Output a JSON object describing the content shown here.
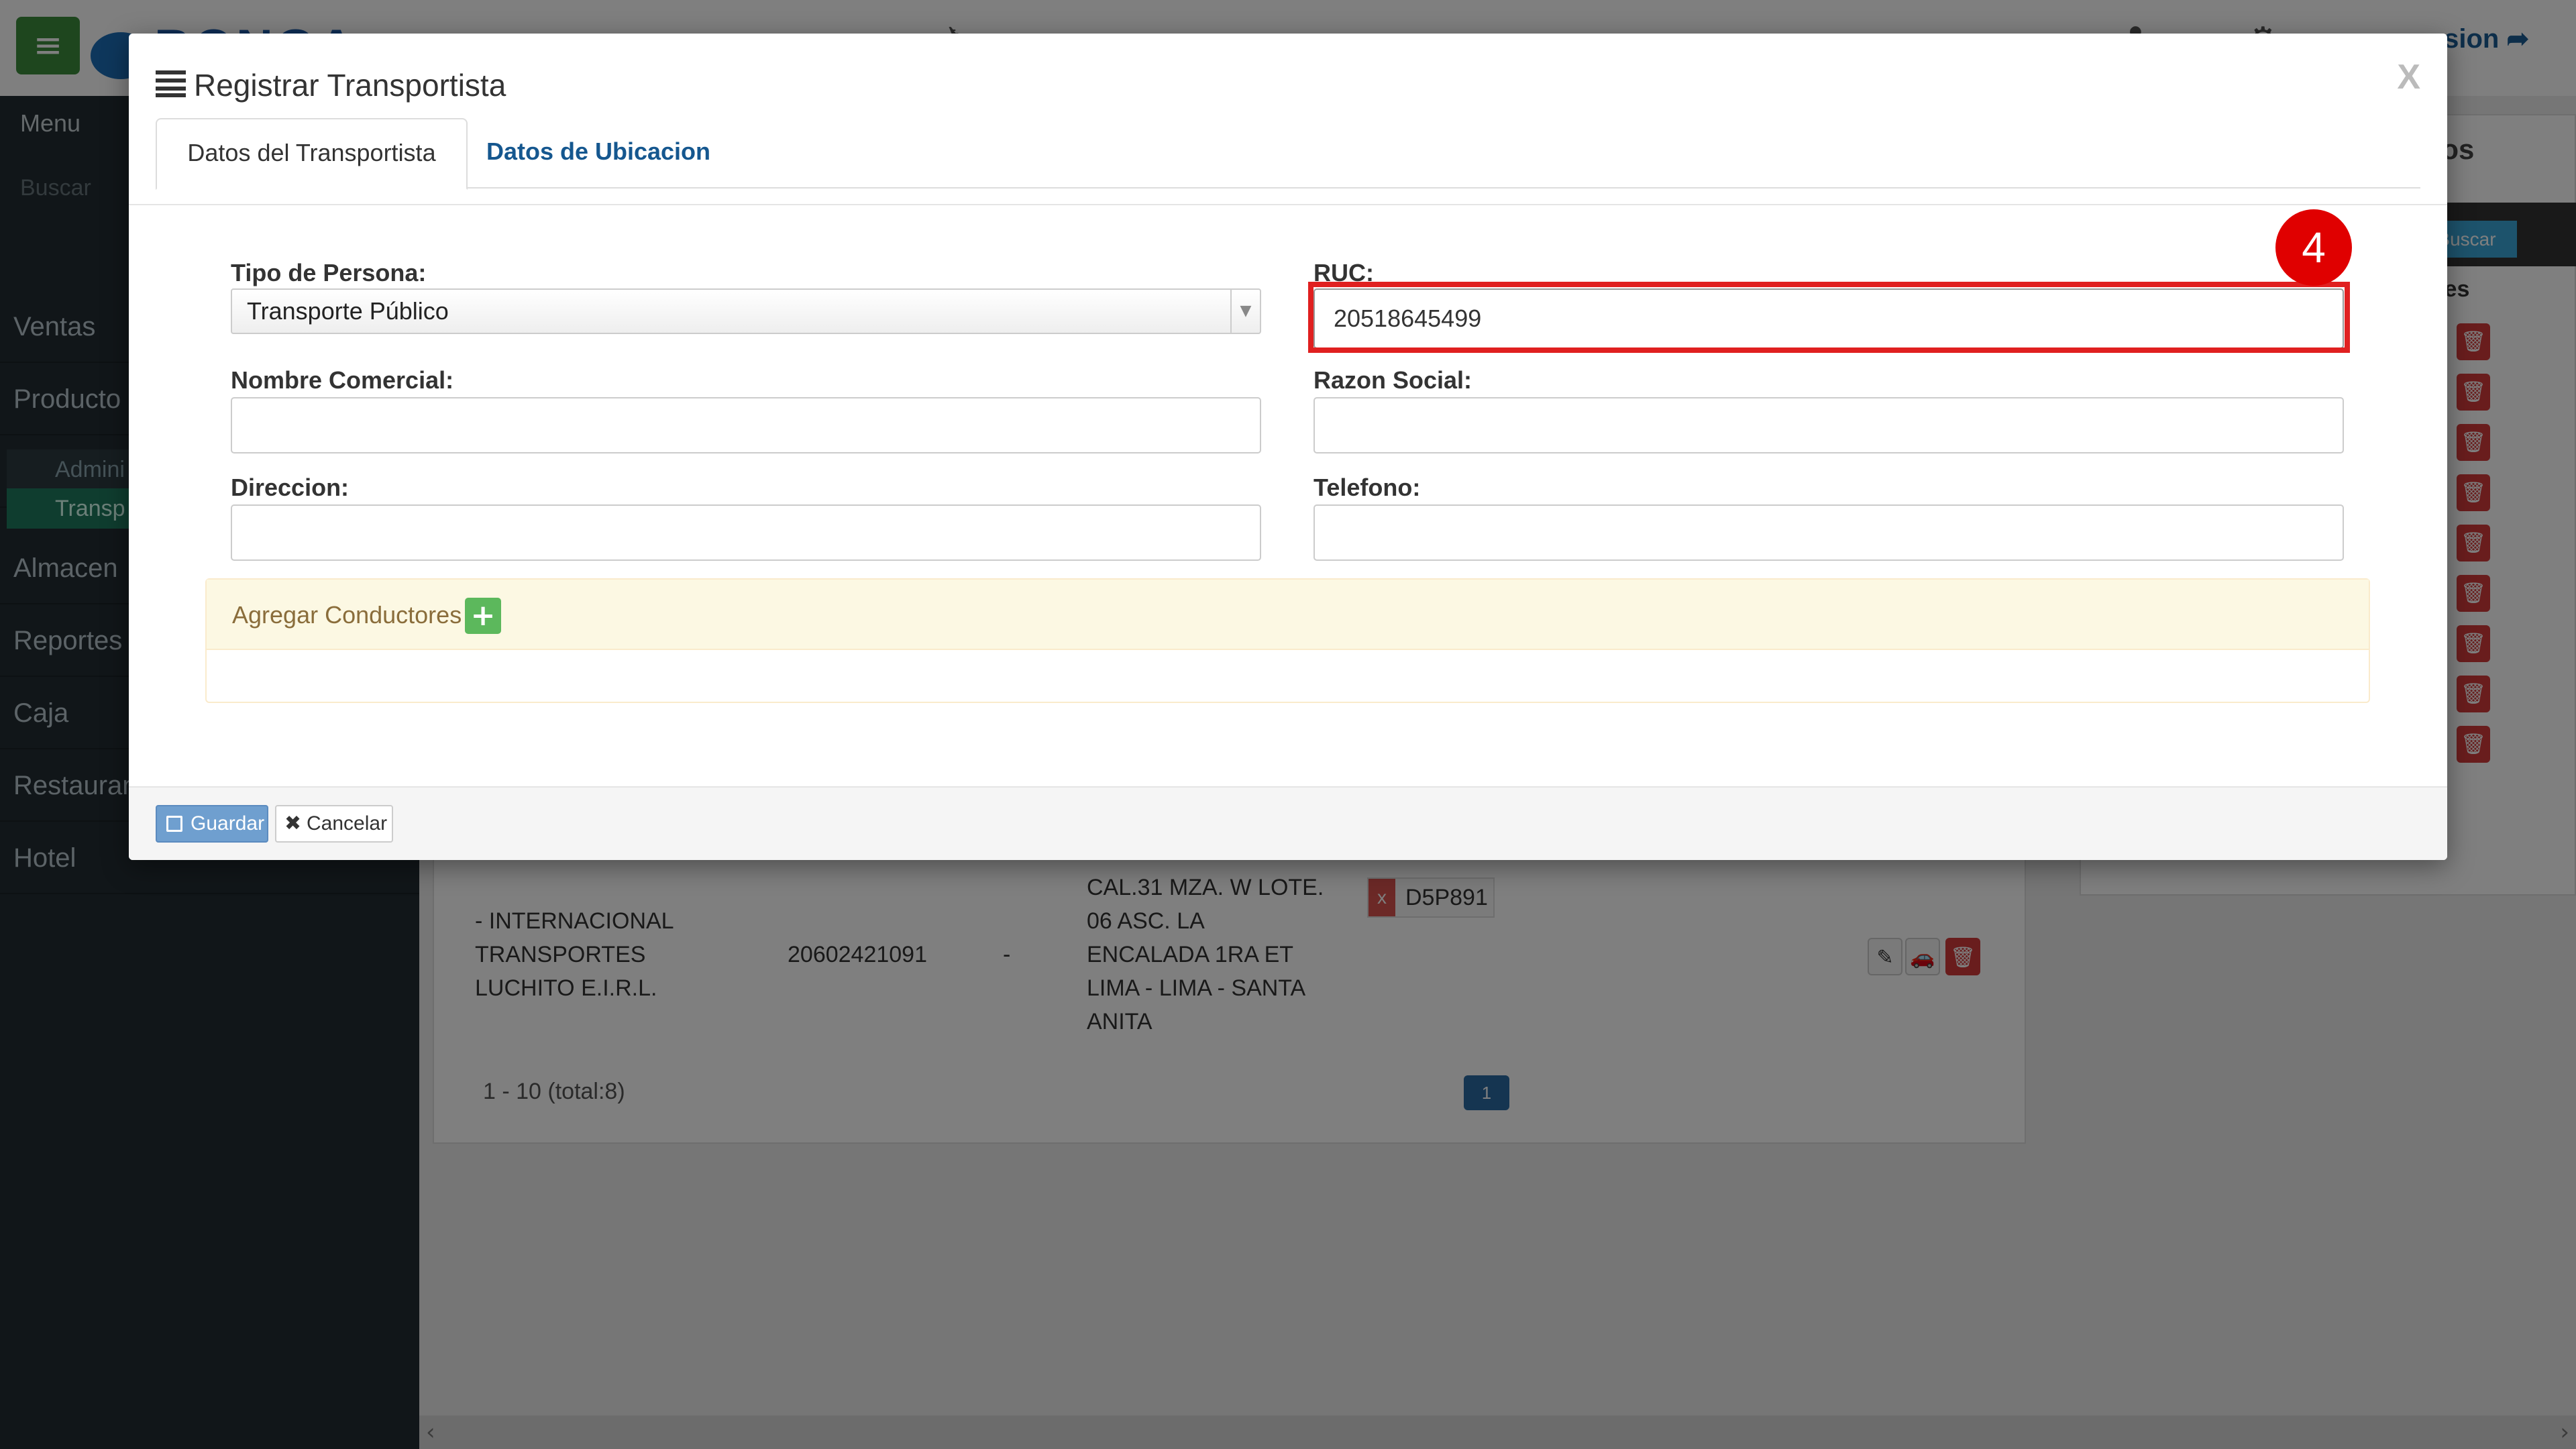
{
  "app": {
    "logo_text": "BONGA",
    "logout_label": "sion",
    "menu_toggle_icon": "≡",
    "top_icons": [
      "✈",
      "♣",
      "⚙"
    ]
  },
  "sidebar": {
    "menu_label": "Menu",
    "search_placeholder": "Buscar",
    "items": [
      {
        "label": "Ventas"
      },
      {
        "label": "Producto"
      },
      {
        "label": "Transporte"
      },
      {
        "label": "Almacen"
      },
      {
        "label": "Reportes"
      },
      {
        "label": "Caja"
      },
      {
        "label": "Restaurant"
      },
      {
        "label": "Hotel"
      }
    ],
    "subitems": [
      {
        "label": "Admini"
      },
      {
        "label": "Transp"
      }
    ]
  },
  "right_panel": {
    "title": "ulos",
    "search_button": "Buscar",
    "column": "ones"
  },
  "table": {
    "row": {
      "name": "- INTERNACIONAL TRANSPORTES LUCHITO E.I.R.L.",
      "ruc": "20602421091",
      "dash": "-",
      "address": "CAL.31 MZA. W LOTE. 06 ASC. LA ENCALADA 1RA ET LIMA - LIMA - SANTA ANITA",
      "plate": "D5P891",
      "plate_remove": "x"
    },
    "pager_summary": "1 - 10 (total:8)",
    "page": "1"
  },
  "modal": {
    "title": "Registrar Transportista",
    "close": "X",
    "tabs": [
      {
        "label": "Datos del Transportista",
        "active": true
      },
      {
        "label": "Datos de Ubicacion",
        "active": false
      }
    ],
    "fields": {
      "tipo_persona": {
        "label": "Tipo de Persona:",
        "value": "Transporte Público"
      },
      "ruc": {
        "label": "RUC:",
        "value": "20518645499"
      },
      "nombre_comercial": {
        "label": "Nombre Comercial:",
        "value": ""
      },
      "razon_social": {
        "label": "Razon Social:",
        "value": ""
      },
      "direccion": {
        "label": "Direccion:",
        "value": ""
      },
      "telefono": {
        "label": "Telefono:",
        "value": ""
      }
    },
    "conductores_label": "Agregar Conductores",
    "buttons": {
      "save": "Guardar",
      "cancel": "Cancelar"
    },
    "step_badge": "4"
  },
  "colors": {
    "sidebar_bg": "#222d32",
    "highlight": "#e02020",
    "tab_link": "#15578f",
    "warning_bg": "#fcf8e3",
    "success": "#5cb85c"
  }
}
